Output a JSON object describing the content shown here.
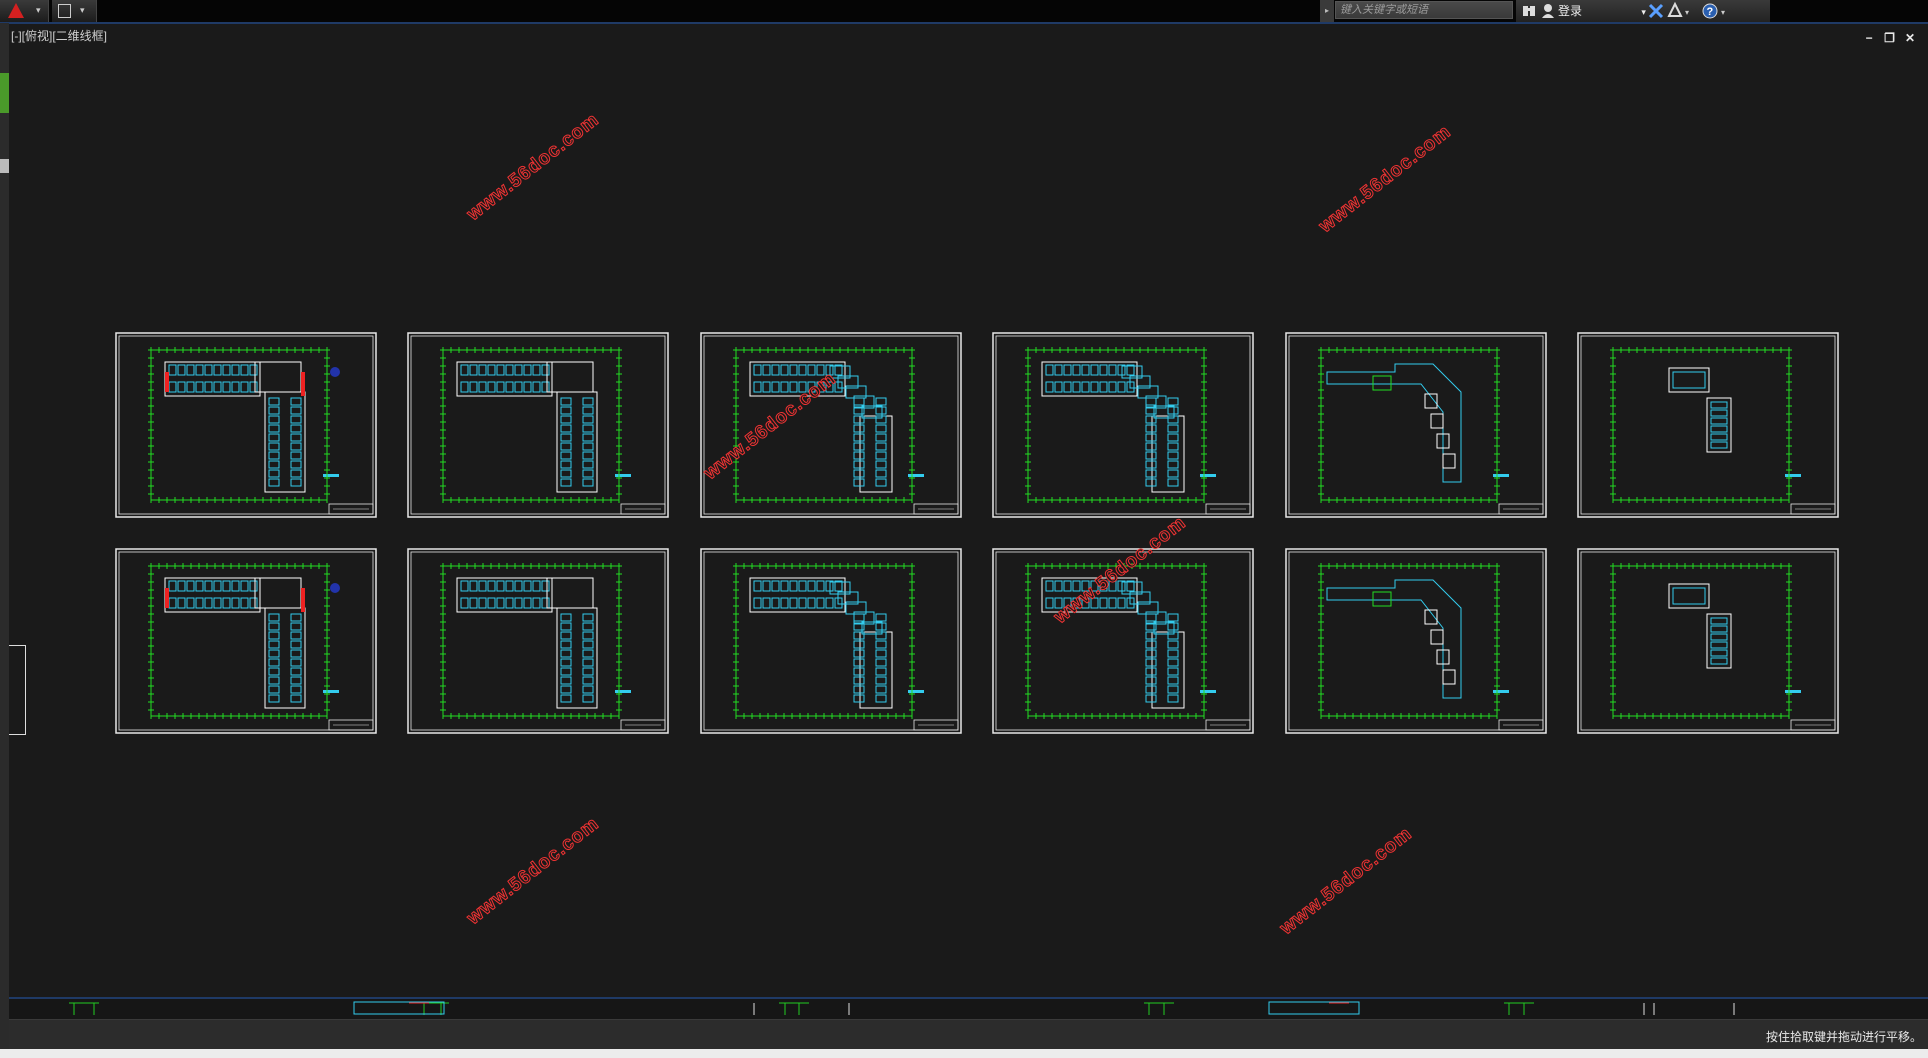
{
  "titlebar": {
    "app_menu_icon": "autocad-a-logo-icon",
    "quick_access_icon": "save-icon",
    "search": {
      "placeholder": "键入关键字或短语"
    },
    "login_label": "登录",
    "icons": [
      "binoculars-icon",
      "user-icon",
      "exchange-x-icon",
      "autodesk360-icon",
      "help-icon"
    ]
  },
  "viewport": {
    "label": "[-][俯视][二维线框]",
    "controls": {
      "minimize": "−",
      "restore": "❐",
      "close": "✕"
    }
  },
  "watermark_text": "www.56doc.com",
  "colors": {
    "background": "#1a1a1a",
    "frame": "#e8e8e8",
    "dimension_lines": "#22dd22",
    "rooms": "#33ccee",
    "walls": "#ffffff",
    "highlight": "#ee2222",
    "watermark": "#ee3333",
    "accent_blue": "#1f3a66"
  },
  "sheets": [
    {
      "id": 1,
      "row": 1,
      "col": 1,
      "plan": "L-shape full"
    },
    {
      "id": 2,
      "row": 1,
      "col": 2,
      "plan": "L-shape full"
    },
    {
      "id": 3,
      "row": 1,
      "col": 3,
      "plan": "L-shape stepped"
    },
    {
      "id": 4,
      "row": 1,
      "col": 4,
      "plan": "L-shape stepped"
    },
    {
      "id": 5,
      "row": 1,
      "col": 5,
      "plan": "outline partial"
    },
    {
      "id": 6,
      "row": 1,
      "col": 6,
      "plan": "small blocks"
    },
    {
      "id": 7,
      "row": 2,
      "col": 1,
      "plan": "L-shape full"
    },
    {
      "id": 8,
      "row": 2,
      "col": 2,
      "plan": "L-shape full"
    },
    {
      "id": 9,
      "row": 2,
      "col": 3,
      "plan": "L-shape stepped"
    },
    {
      "id": 10,
      "row": 2,
      "col": 4,
      "plan": "L-shape stepped"
    },
    {
      "id": 11,
      "row": 2,
      "col": 5,
      "plan": "outline partial"
    },
    {
      "id": 12,
      "row": 2,
      "col": 6,
      "plan": "small blocks"
    }
  ],
  "status": {
    "message": "按住拾取键并拖动进行平移。"
  }
}
